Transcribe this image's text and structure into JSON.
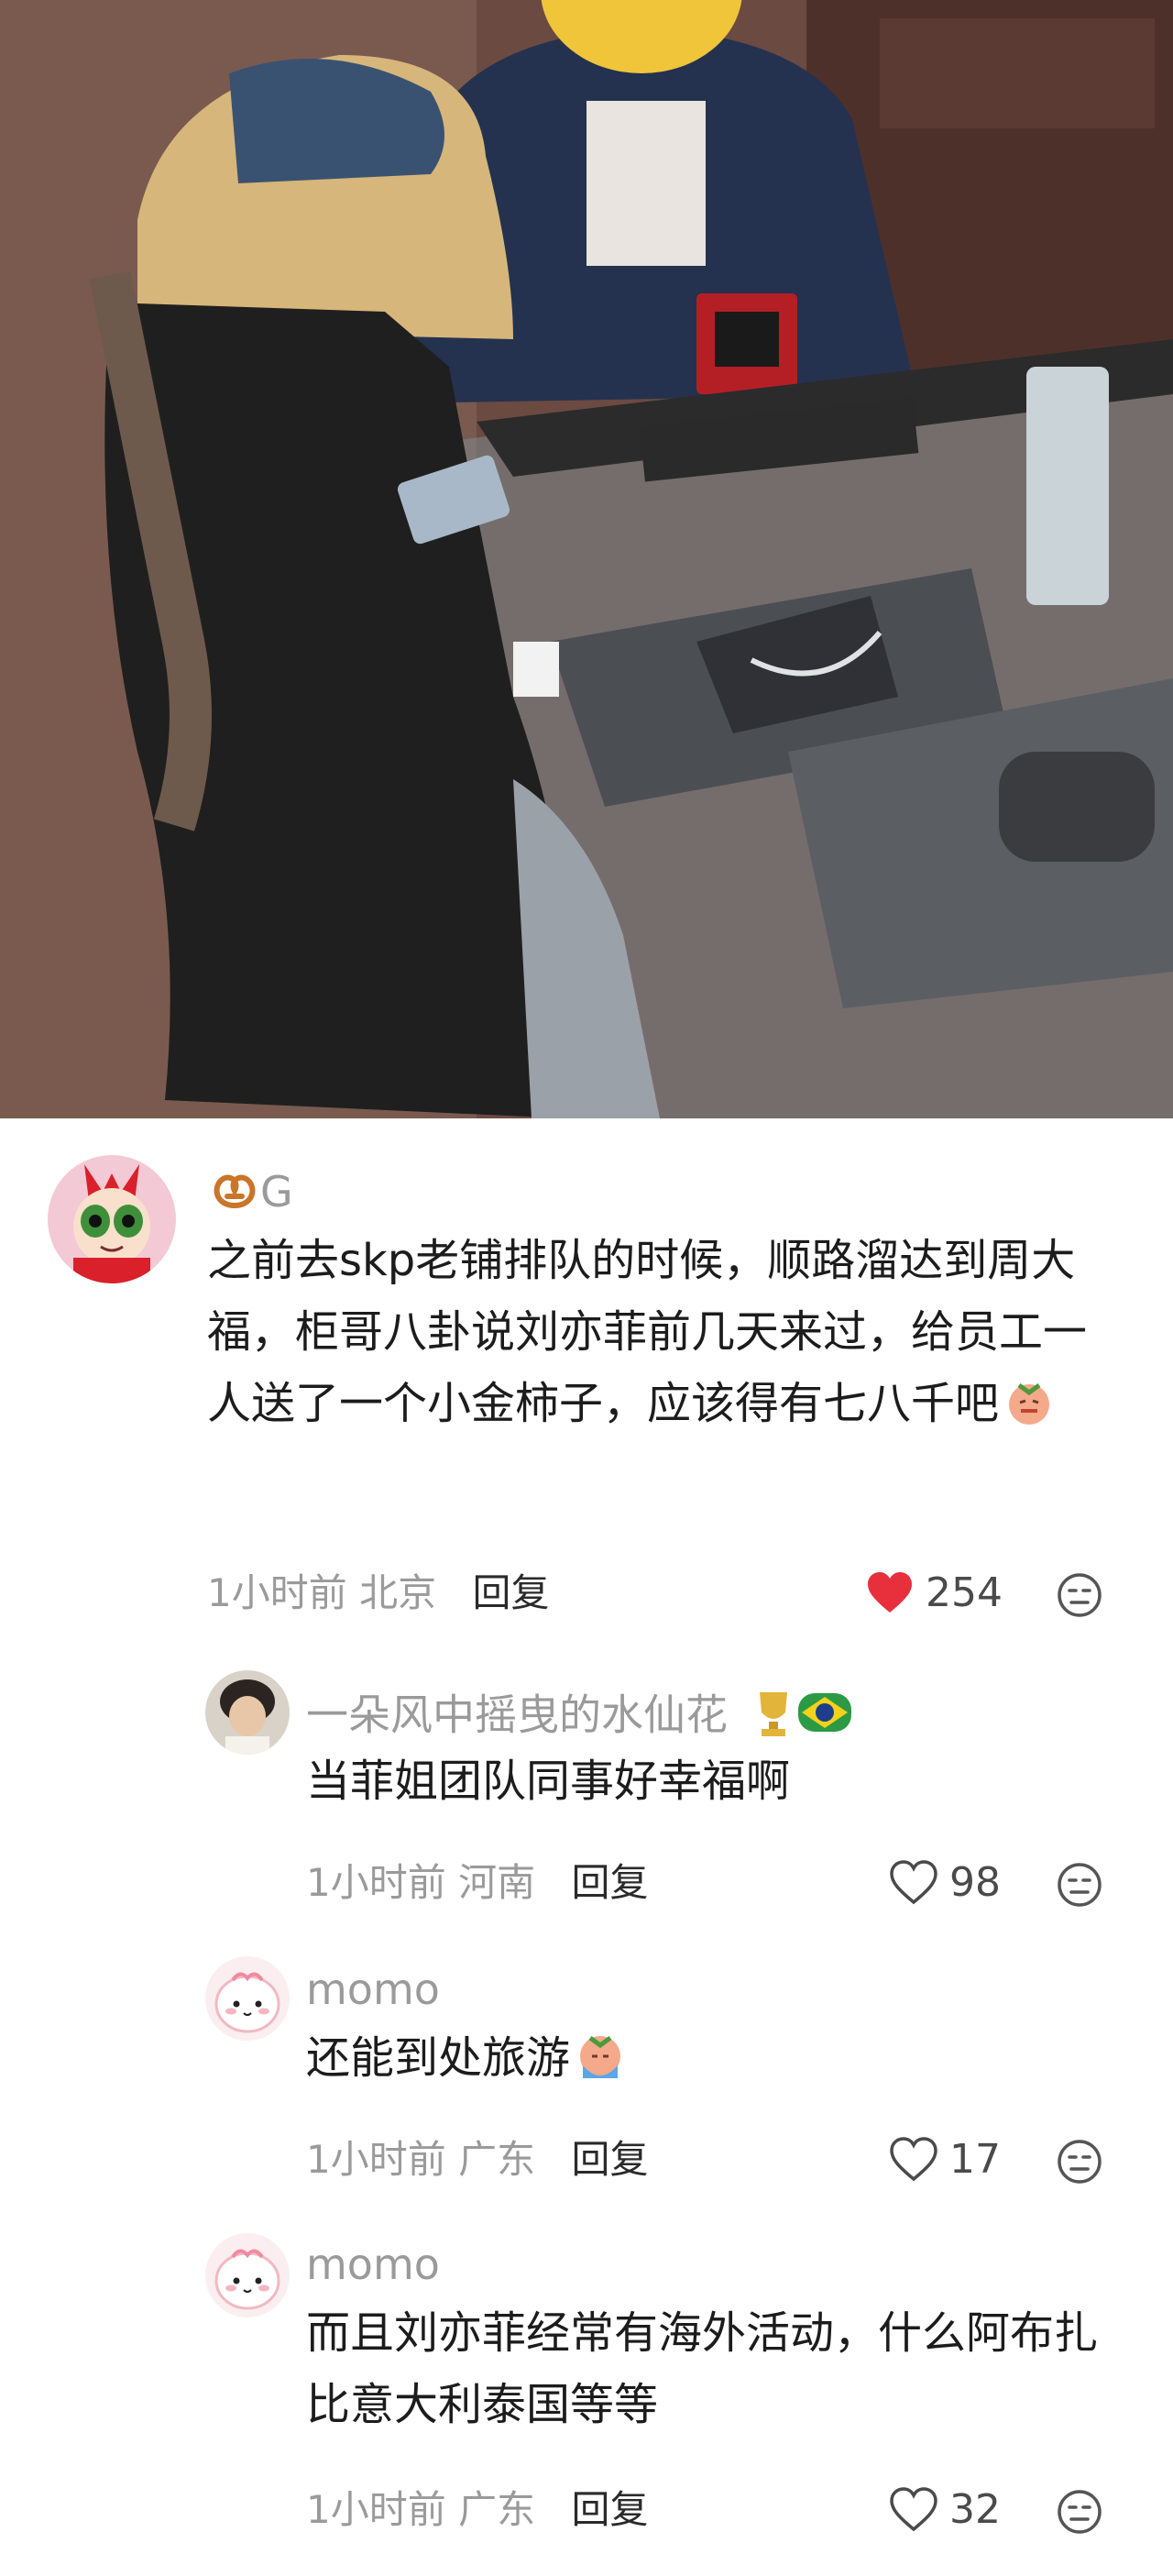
{
  "comments": [
    {
      "username": "G",
      "content": "之前去skp老铺排队的时候，顺路溜达到周大福，柜哥八卦说刘亦菲前几天来过，给员工一人送了一个小金柿子，应该得有七八千吧",
      "time": "1小时前",
      "location": "北京",
      "reply_label": "回复",
      "likes": "254",
      "liked": true
    },
    {
      "username": "一朵风中摇曳的水仙花",
      "content": "当菲姐团队同事好幸福啊",
      "time": "1小时前",
      "location": "河南",
      "reply_label": "回复",
      "likes": "98",
      "liked": false
    },
    {
      "username": "momo",
      "content": "还能到处旅游",
      "time": "1小时前",
      "location": "广东",
      "reply_label": "回复",
      "likes": "17",
      "liked": false
    },
    {
      "username": "momo",
      "content": "而且刘亦菲经常有海外活动，什么阿布扎比意大利泰国等等",
      "time": "1小时前",
      "location": "广东",
      "reply_label": "回复",
      "likes": "32",
      "liked": false
    }
  ],
  "colors": {
    "liked_heart": "#e8303c",
    "muted_text": "#9a9a9a",
    "body_text": "#1c1c1c"
  },
  "icons": [
    "pretzel-icon",
    "heart-icon",
    "dislike-face-icon",
    "brazil-flag-icon",
    "trophy-icon",
    "emoji-icon"
  ]
}
